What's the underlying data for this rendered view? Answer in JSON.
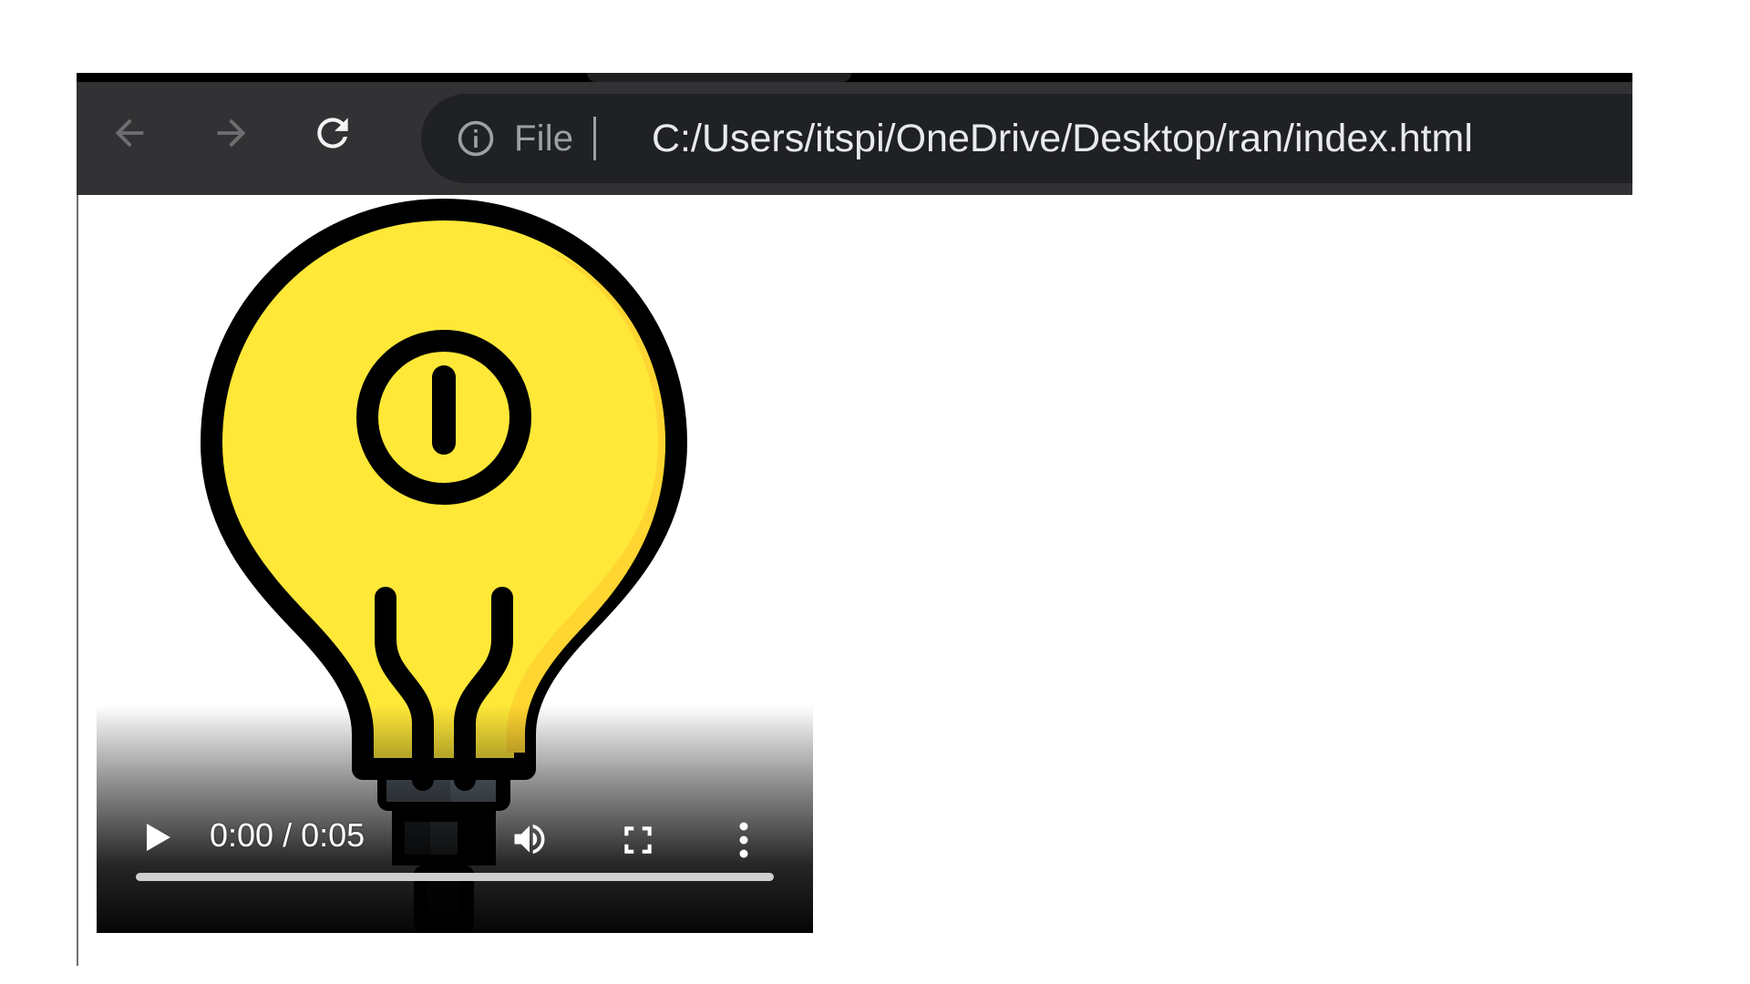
{
  "browser": {
    "nav": {
      "back_icon": "arrow-left-icon",
      "forward_icon": "arrow-right-icon",
      "reload_icon": "reload-icon"
    },
    "omnibox": {
      "info_icon": "info-circle-icon",
      "scheme_chip": "File",
      "url": "C:/Users/itspi/OneDrive/Desktop/ran/index.html"
    },
    "colors": {
      "toolbar": "#323234",
      "omnibox": "#202124",
      "url_text": "#e8eaed",
      "muted_text": "#9aa0a6"
    }
  },
  "page": {
    "video": {
      "poster": "lightbulb-image",
      "controls": {
        "play_icon": "play-icon",
        "time": "0:00 / 0:05",
        "mute_icon": "volume-icon",
        "fullscreen_icon": "fullscreen-icon",
        "more_icon": "more-vertical-icon",
        "progress": 0
      },
      "colors": {
        "bulb": "#ffe838",
        "bulb_shade": "#ffd531",
        "outline": "#000000"
      }
    }
  }
}
